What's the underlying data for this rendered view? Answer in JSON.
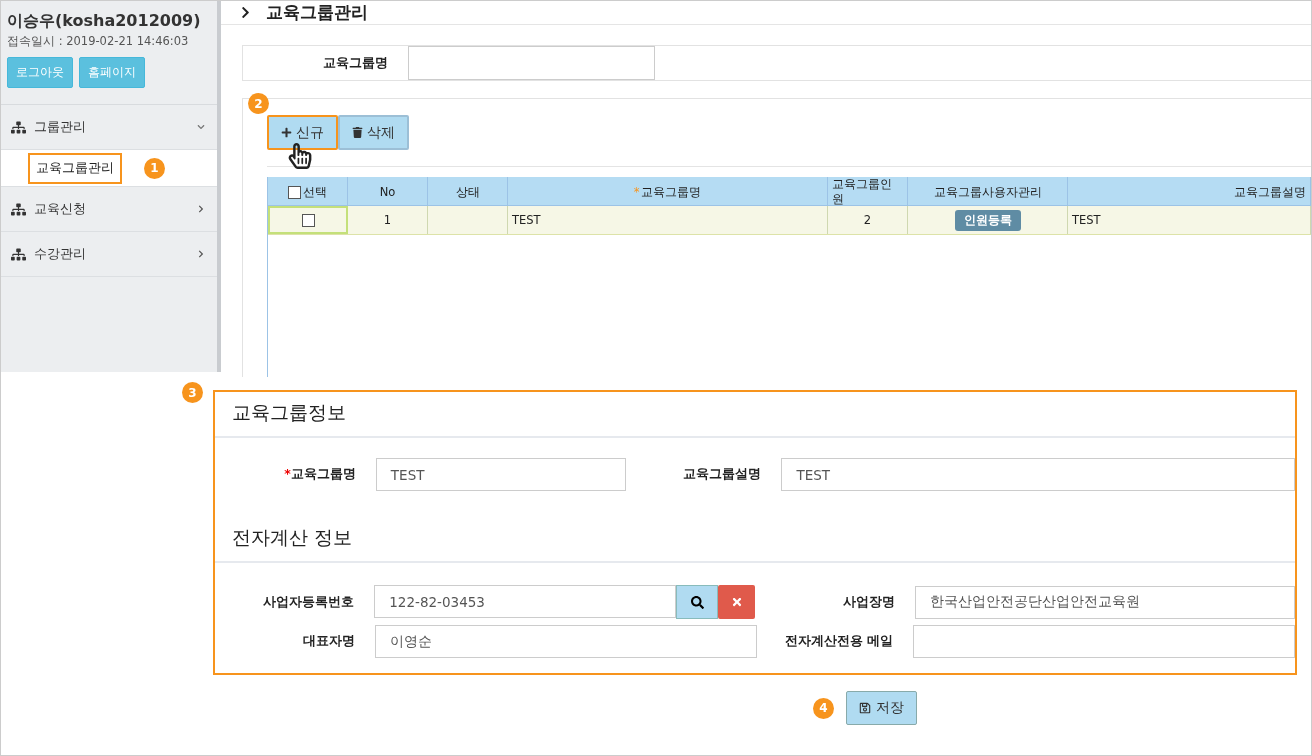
{
  "user": {
    "name": "이승우(kosha2012009)",
    "login_time": "접속일시 : 2019-02-21 14:46:03",
    "buttons": [
      "로그아웃",
      "홈페이지"
    ]
  },
  "menu": [
    {
      "label": "그룹관리",
      "expanded": true,
      "children": [
        {
          "label": "교육그룹관리",
          "selected": true,
          "step": "1"
        }
      ]
    },
    {
      "label": "교육신청",
      "expanded": false
    },
    {
      "label": "수강관리",
      "expanded": false
    }
  ],
  "page_title": "교육그룹관리",
  "search": {
    "label": "교육그룹명"
  },
  "toolbar": {
    "step": "2",
    "buttons": [
      {
        "kind": "add",
        "label": "신규",
        "highlighted": true
      },
      {
        "kind": "delete",
        "label": "삭제",
        "highlighted": false
      }
    ]
  },
  "grid": {
    "columns": [
      {
        "label": "선택",
        "kind": "checkbox"
      },
      {
        "label": "No"
      },
      {
        "label": "상태"
      },
      {
        "label": "교육그룹명",
        "mark": "*"
      },
      {
        "label": "교육그룹인원"
      },
      {
        "label": "교육그룹사용자관리"
      },
      {
        "label": "교육그룹설명"
      }
    ],
    "rows": [
      {
        "selected": true,
        "checked": false,
        "no": "1",
        "group_name": "TEST",
        "members": "2",
        "manage_button": "인원등록",
        "description": "TEST"
      }
    ]
  },
  "detail": {
    "step": "3",
    "sections": [
      {
        "title": "교육그룹정보",
        "fields": [
          {
            "label": "교육그룹명",
            "mark": "*",
            "value": "TEST"
          },
          {
            "label": "교육그룹설명",
            "value": "TEST"
          }
        ]
      },
      {
        "title": "전자계산 정보",
        "fields": [
          {
            "label": "사업자등록번호",
            "kind": "lookup",
            "value": "122-82-03453"
          },
          {
            "label": "사업장명",
            "value": "한국산업안전공단산업안전교육원"
          },
          {
            "label": "대표자명",
            "value": "이영순"
          },
          {
            "label": "전자계산전용 메일"
          }
        ]
      }
    ]
  },
  "save": {
    "step": "4",
    "label": "저장"
  }
}
